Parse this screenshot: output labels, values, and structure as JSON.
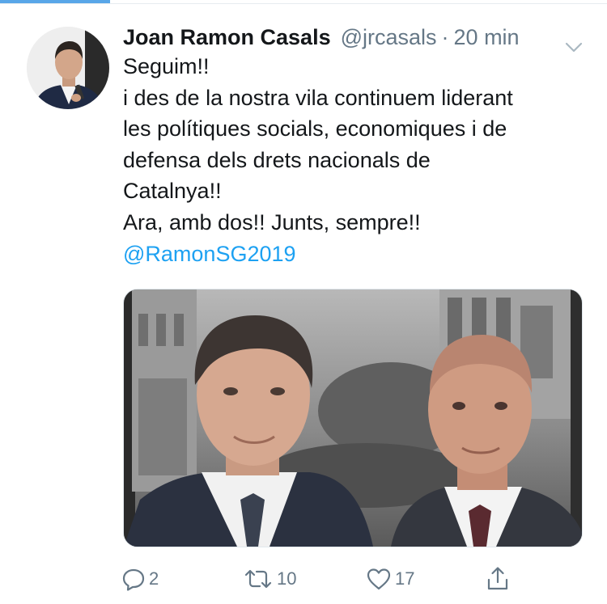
{
  "tweet": {
    "author_name": "Joan Ramon Casals",
    "author_handle": "@jrcasals",
    "separator": "·",
    "timestamp": "20 min",
    "text_lines": [
      "Seguim!!",
      "i des de la nostra vila continuem liderant",
      "les polítiques socials, economiques i de",
      "defensa dels drets nacionals de",
      "Catalnya!!",
      "Ara, amb dos!!  Junts, sempre!!"
    ],
    "mention": "@RamonSG2019"
  },
  "actions": {
    "reply_count": "2",
    "retweet_count": "10",
    "like_count": "17"
  },
  "icons": {
    "reply": "reply-icon",
    "retweet": "retweet-icon",
    "like": "heart-icon",
    "share": "share-icon",
    "caret": "chevron-down-icon"
  },
  "colors": {
    "accent": "#1da1f2",
    "muted": "#657786",
    "text": "#14171a"
  }
}
